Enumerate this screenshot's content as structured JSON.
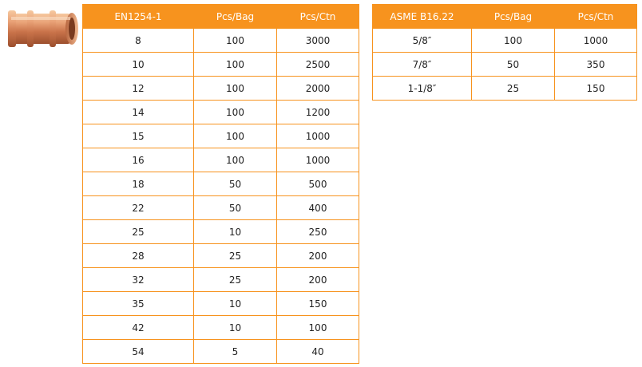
{
  "tables": [
    {
      "headers": [
        "EN1254-1",
        "Pcs/Bag",
        "Pcs/Ctn"
      ],
      "rows": [
        [
          "8",
          "100",
          "3000"
        ],
        [
          "10",
          "100",
          "2500"
        ],
        [
          "12",
          "100",
          "2000"
        ],
        [
          "14",
          "100",
          "1200"
        ],
        [
          "15",
          "100",
          "1000"
        ],
        [
          "16",
          "100",
          "1000"
        ],
        [
          "18",
          "50",
          "500"
        ],
        [
          "22",
          "50",
          "400"
        ],
        [
          "25",
          "10",
          "250"
        ],
        [
          "28",
          "25",
          "200"
        ],
        [
          "32",
          "25",
          "200"
        ],
        [
          "35",
          "10",
          "150"
        ],
        [
          "42",
          "10",
          "100"
        ],
        [
          "54",
          "5",
          "40"
        ]
      ]
    },
    {
      "headers": [
        "ASME B16.22",
        "Pcs/Bag",
        "Pcs/Ctn"
      ],
      "rows": [
        [
          "5/8″",
          "100",
          "1000"
        ],
        [
          "7/8″",
          "50",
          "350"
        ],
        [
          "1-1/8″",
          "25",
          "150"
        ]
      ]
    }
  ]
}
